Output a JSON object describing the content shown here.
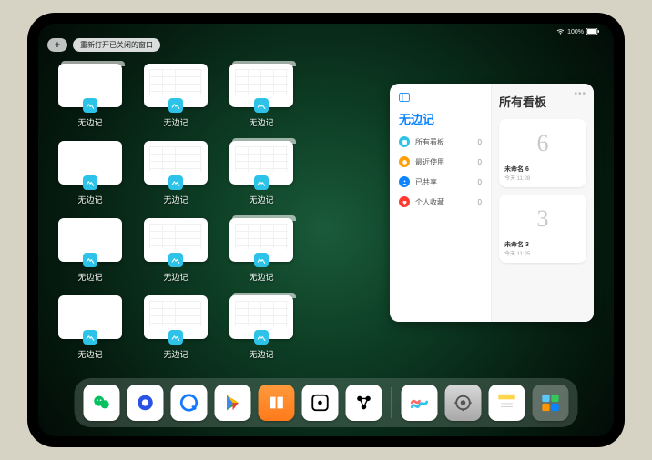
{
  "statusbar": {
    "battery": "100%"
  },
  "topbar": {
    "plus": "+",
    "reopen_label": "重新打开已关闭的窗口"
  },
  "app_name": "无边记",
  "grid": {
    "items": [
      {
        "label": "无边记",
        "variant": "stacked blank"
      },
      {
        "label": "无边记",
        "variant": "grid-content"
      },
      {
        "label": "无边记",
        "variant": "stacked grid-content"
      },
      {
        "label": "无边记",
        "variant": "blank"
      },
      {
        "label": "无边记",
        "variant": "grid-content"
      },
      {
        "label": "无边记",
        "variant": "stacked grid-content"
      },
      {
        "label": "无边记",
        "variant": "blank"
      },
      {
        "label": "无边记",
        "variant": "grid-content"
      },
      {
        "label": "无边记",
        "variant": "stacked grid-content"
      },
      {
        "label": "无边记",
        "variant": "blank"
      },
      {
        "label": "无边记",
        "variant": "grid-content"
      },
      {
        "label": "无边记",
        "variant": "stacked grid-content"
      }
    ]
  },
  "panel": {
    "left_title": "无边记",
    "right_title": "所有看板",
    "sidebar": [
      {
        "label": "所有看板",
        "count": "0",
        "color": "#2dc3e8"
      },
      {
        "label": "最近使用",
        "count": "0",
        "color": "#ff9f0a"
      },
      {
        "label": "已共享",
        "count": "0",
        "color": "#0a84ff"
      },
      {
        "label": "个人收藏",
        "count": "0",
        "color": "#ff3b30"
      }
    ],
    "boards": [
      {
        "glyph": "6",
        "title": "未命名 6",
        "sub": "今天 11:28"
      },
      {
        "glyph": "3",
        "title": "未命名 3",
        "sub": "今天 11:25"
      }
    ]
  },
  "dock": {
    "items": [
      {
        "name": "wechat",
        "bg": "#fff"
      },
      {
        "name": "quark",
        "bg": "#fff"
      },
      {
        "name": "alipay-q",
        "bg": "#fff"
      },
      {
        "name": "play",
        "bg": "#fff"
      },
      {
        "name": "books",
        "bg": "linear-gradient(#ff9a3c,#ff7a1a)"
      },
      {
        "name": "dice",
        "bg": "#fff"
      },
      {
        "name": "connect",
        "bg": "#fff"
      },
      {
        "name": "freeform",
        "bg": "#fff"
      },
      {
        "name": "settings",
        "bg": "linear-gradient(#d8d8d8,#a8a8a8)"
      },
      {
        "name": "notes",
        "bg": "#fff"
      },
      {
        "name": "folder",
        "bg": "rgba(255,255,255,0.25)"
      }
    ]
  }
}
